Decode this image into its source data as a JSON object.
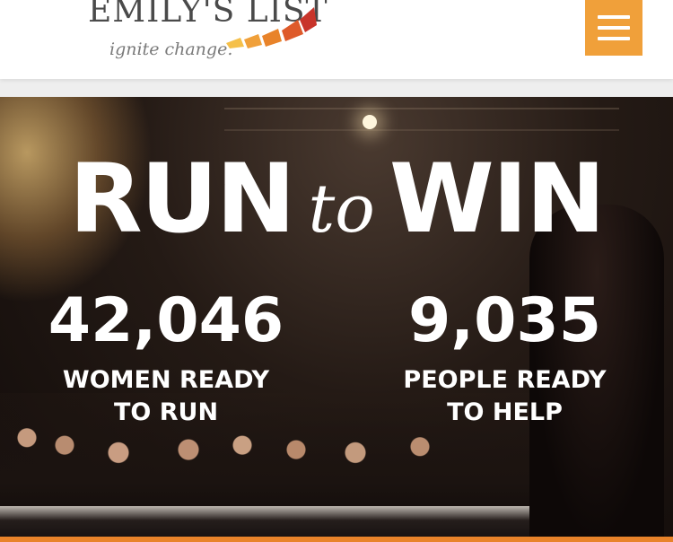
{
  "header": {
    "logo_name": "EMILY'S LIST",
    "logo_tagline": "ignite change.",
    "logo_colors": [
      "#f5c04a",
      "#f0a03a",
      "#e8832a",
      "#de5a2a",
      "#c8342a"
    ],
    "menu_icon": "hamburger-menu-icon",
    "menu_color": "#f0a03a"
  },
  "hero": {
    "headline_run": "RUN",
    "headline_to": "to",
    "headline_win": "WIN",
    "stats": [
      {
        "number": "42,046",
        "label_line1": "WOMEN READY",
        "label_line2": "TO RUN"
      },
      {
        "number": "9,035",
        "label_line1": "PEOPLE READY",
        "label_line2": "TO HELP"
      }
    ]
  }
}
